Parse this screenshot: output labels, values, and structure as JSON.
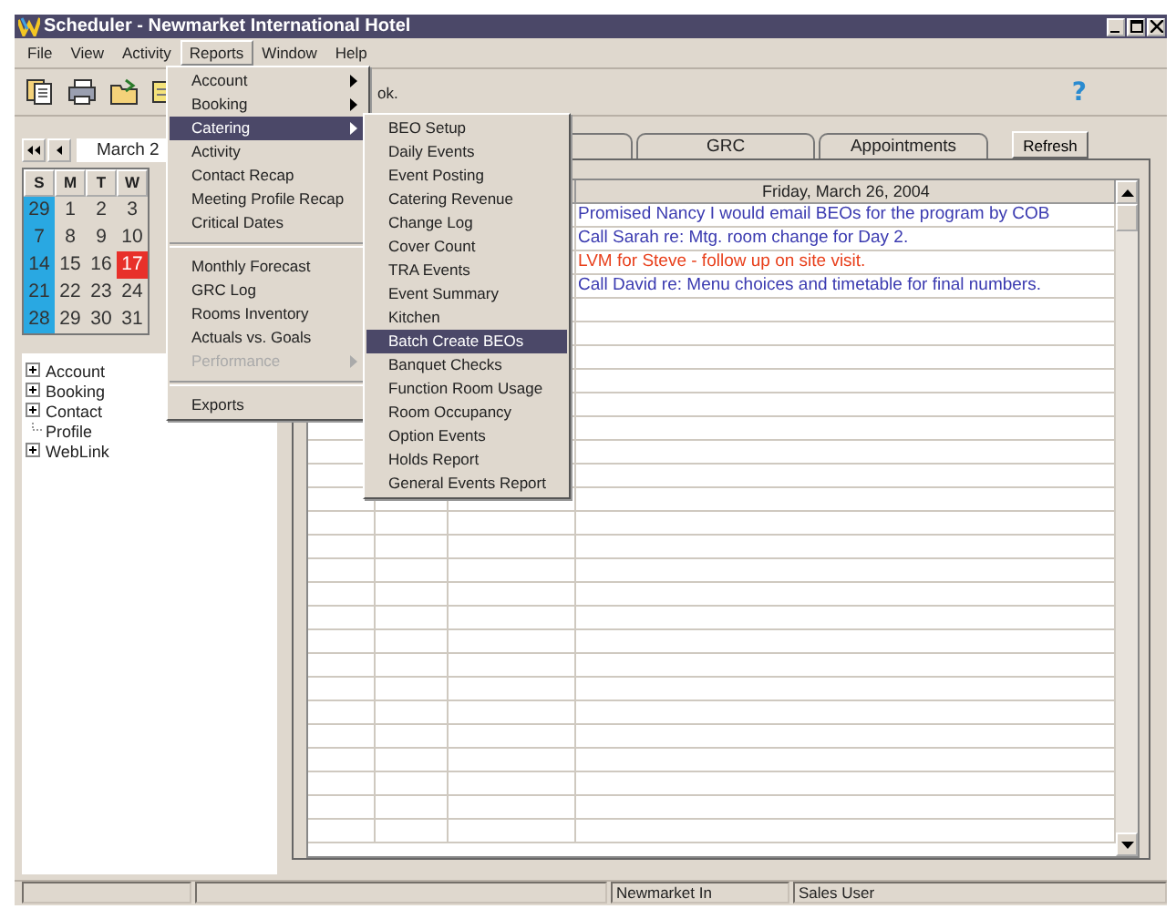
{
  "window": {
    "title": "Scheduler - Newmarket International Hotel"
  },
  "menubar": [
    {
      "label": "File",
      "selected": false
    },
    {
      "label": "View",
      "selected": false
    },
    {
      "label": "Activity",
      "selected": false
    },
    {
      "label": "Reports",
      "selected": true
    },
    {
      "label": "Window",
      "selected": false
    },
    {
      "label": "Help",
      "selected": false
    }
  ],
  "toolbar": {
    "text": "ok.",
    "help": "?"
  },
  "calendar": {
    "month": "March 2",
    "weekdays": [
      "S",
      "M",
      "T",
      "W"
    ],
    "weeks": [
      [
        {
          "day": "29",
          "selected": false
        },
        {
          "day": "1",
          "selected": false
        },
        {
          "day": "2",
          "selected": false
        },
        {
          "day": "3",
          "selected": false
        }
      ],
      [
        {
          "day": "7",
          "selected": false
        },
        {
          "day": "8",
          "selected": false
        },
        {
          "day": "9",
          "selected": false
        },
        {
          "day": "10",
          "selected": false
        }
      ],
      [
        {
          "day": "14",
          "selected": false
        },
        {
          "day": "15",
          "selected": false
        },
        {
          "day": "16",
          "selected": false
        },
        {
          "day": "17",
          "selected": true
        }
      ],
      [
        {
          "day": "21",
          "selected": false
        },
        {
          "day": "22",
          "selected": false
        },
        {
          "day": "23",
          "selected": false
        },
        {
          "day": "24",
          "selected": false
        }
      ],
      [
        {
          "day": "28",
          "selected": false
        },
        {
          "day": "29",
          "selected": false
        },
        {
          "day": "30",
          "selected": false
        },
        {
          "day": "31",
          "selected": false
        }
      ]
    ]
  },
  "tree": [
    {
      "label": "Account",
      "expandable": true
    },
    {
      "label": "Booking",
      "expandable": true
    },
    {
      "label": "Contact",
      "expandable": true
    },
    {
      "label": "Profile",
      "expandable": false
    },
    {
      "label": "WebLink",
      "expandable": true
    }
  ],
  "tabs": [
    {
      "label": "GRC",
      "selected": false
    },
    {
      "label": "Appointments",
      "selected": false
    }
  ],
  "refresh_button": "Refresh",
  "grid": {
    "header": "Friday, March 26, 2004",
    "notes": [
      {
        "text": "Promised Nancy I would email BEOs for the program by COB",
        "color": "#3a3ab0"
      },
      {
        "text": "Call Sarah re: Mtg. room change for Day 2.",
        "color": "#3a3ab0"
      },
      {
        "text": "LVM for Steve - follow up on site visit.",
        "color": "#e8401c"
      },
      {
        "text": "Call David re: Menu choices and timetable for final numbers.",
        "color": "#3a3ab0"
      }
    ]
  },
  "reports_menu": [
    {
      "kind": "item",
      "label": "Account",
      "submenu": true,
      "selected": false,
      "disabled": false
    },
    {
      "kind": "item",
      "label": "Booking",
      "submenu": true,
      "selected": false,
      "disabled": false
    },
    {
      "kind": "item",
      "label": "Catering",
      "submenu": true,
      "selected": true,
      "disabled": false
    },
    {
      "kind": "item",
      "label": "Activity",
      "submenu": false,
      "selected": false,
      "disabled": false
    },
    {
      "kind": "item",
      "label": "Contact Recap",
      "submenu": false,
      "selected": false,
      "disabled": false
    },
    {
      "kind": "item",
      "label": "Meeting Profile Recap",
      "submenu": false,
      "selected": false,
      "disabled": false
    },
    {
      "kind": "item",
      "label": "Critical Dates",
      "submenu": false,
      "selected": false,
      "disabled": false
    },
    {
      "kind": "separator"
    },
    {
      "kind": "item",
      "label": "Monthly Forecast",
      "submenu": false,
      "selected": false,
      "disabled": false
    },
    {
      "kind": "item",
      "label": "GRC Log",
      "submenu": false,
      "selected": false,
      "disabled": false
    },
    {
      "kind": "item",
      "label": "Rooms Inventory",
      "submenu": false,
      "selected": false,
      "disabled": false
    },
    {
      "kind": "item",
      "label": "Actuals vs. Goals",
      "submenu": false,
      "selected": false,
      "disabled": false
    },
    {
      "kind": "item",
      "label": "Performance",
      "submenu": true,
      "selected": false,
      "disabled": true
    },
    {
      "kind": "separator"
    },
    {
      "kind": "item",
      "label": "Exports",
      "submenu": false,
      "selected": false,
      "disabled": false
    }
  ],
  "catering_menu": [
    {
      "label": "BEO Setup",
      "selected": false
    },
    {
      "label": "Daily Events",
      "selected": false
    },
    {
      "label": "Event Posting",
      "selected": false
    },
    {
      "label": "Catering Revenue",
      "selected": false
    },
    {
      "label": "Change Log",
      "selected": false
    },
    {
      "label": "Cover Count",
      "selected": false
    },
    {
      "label": "TRA Events",
      "selected": false
    },
    {
      "label": "Event Summary",
      "selected": false
    },
    {
      "label": "Kitchen",
      "selected": false
    },
    {
      "label": "Batch Create BEOs",
      "selected": true
    },
    {
      "label": "Banquet Checks",
      "selected": false
    },
    {
      "label": "Function Room Usage",
      "selected": false
    },
    {
      "label": "Room Occupancy",
      "selected": false
    },
    {
      "label": "Option Events",
      "selected": false
    },
    {
      "label": "Holds Report",
      "selected": false
    },
    {
      "label": "General Events Report",
      "selected": false
    }
  ],
  "status_bar": [
    "Newmarket In",
    "Sales User"
  ]
}
